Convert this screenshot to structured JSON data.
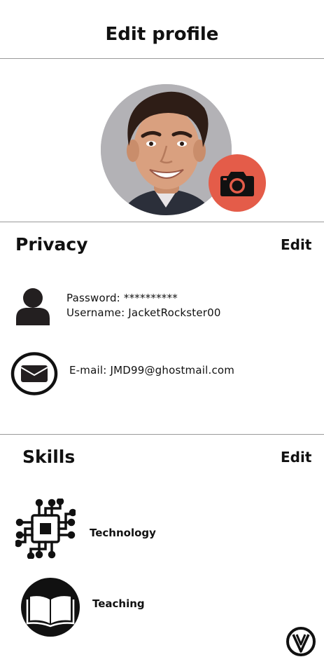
{
  "header": {
    "title": "Edit profile"
  },
  "profile": {
    "avatar_icon": "person-photo",
    "camera_icon": "camera-icon",
    "camera_color": "#e45c49"
  },
  "privacy": {
    "title": "Privacy",
    "edit_label": "Edit",
    "password_label": "Password:",
    "password_value": "**********",
    "username_label": "Username:",
    "username_value": "JacketRockster00",
    "email_label": "E-mail:",
    "email_value": "JMD99@ghostmail.com"
  },
  "skills": {
    "title": "Skills",
    "edit_label": "Edit",
    "items": [
      {
        "label": "Technology",
        "icon": "circuit-chip-icon"
      },
      {
        "label": "Teaching",
        "icon": "open-book-icon"
      }
    ]
  },
  "footer": {
    "logo_icon": "vv-logo-icon"
  }
}
